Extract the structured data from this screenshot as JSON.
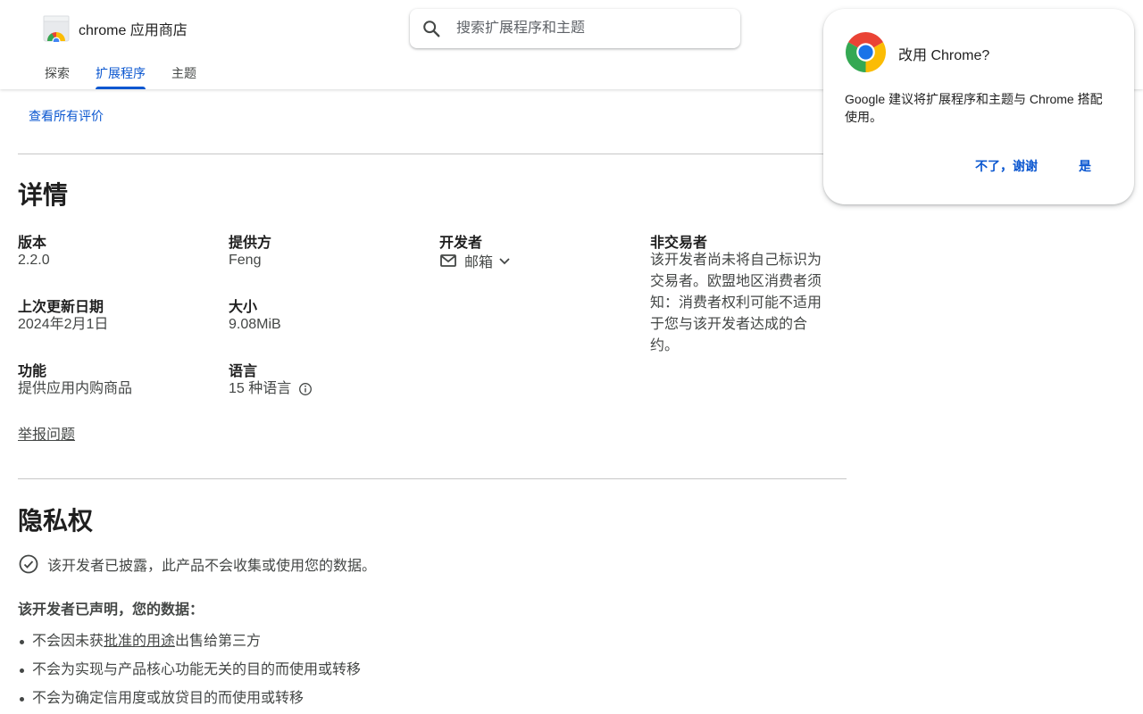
{
  "header": {
    "brand_name": "chrome 应用商店",
    "search_placeholder": "搜索扩展程序和主题",
    "tabs": [
      {
        "label": "探索",
        "active": false
      },
      {
        "label": "扩展程序",
        "active": true
      },
      {
        "label": "主题",
        "active": false
      }
    ]
  },
  "reviews": {
    "view_all_label": "查看所有评价"
  },
  "details": {
    "title": "详情",
    "version_label": "版本",
    "version_value": "2.2.0",
    "offered_by_label": "提供方",
    "offered_by_value": "Feng",
    "developer_label": "开发者",
    "developer_email_label": "邮箱",
    "non_trader_label": "非交易者",
    "non_trader_text": "该开发者尚未将自己标识为交易者。欧盟地区消费者须知：消费者权利可能不适用于您与该开发者达成的合约。",
    "updated_label": "上次更新日期",
    "updated_value": "2024年2月1日",
    "size_label": "大小",
    "size_value": "9.08MiB",
    "features_label": "功能",
    "features_value": "提供应用内购商品",
    "languages_label": "语言",
    "languages_value": "15 种语言",
    "report_label": "举报问题"
  },
  "privacy": {
    "title": "隐私权",
    "disclosure": "该开发者已披露，此产品不会收集或使用您的数据。",
    "declared_heading": "该开发者已声明，您的数据：",
    "bullet1_prefix": "不会因未获",
    "bullet1_link": "批准的用途",
    "bullet1_suffix": "出售给第三方",
    "bullet2": "不会为实现与产品核心功能无关的目的而使用或转移",
    "bullet3": "不会为确定信用度或放贷目的而使用或转移"
  },
  "popup": {
    "title": "改用 Chrome?",
    "description": "Google 建议将扩展程序和主题与 Chrome 搭配使用。",
    "no_label": "不了，谢谢",
    "yes_label": "是"
  },
  "colors": {
    "accent": "#0b57d0",
    "text_primary": "#1f1f1f",
    "text_secondary": "#444746",
    "divider": "#c7c7c7"
  },
  "icons": [
    "chrome-web-store-logo-icon",
    "search-icon",
    "mail-icon",
    "chevron-down-icon",
    "info-icon",
    "check-circle-icon",
    "chrome-logo-icon"
  ]
}
